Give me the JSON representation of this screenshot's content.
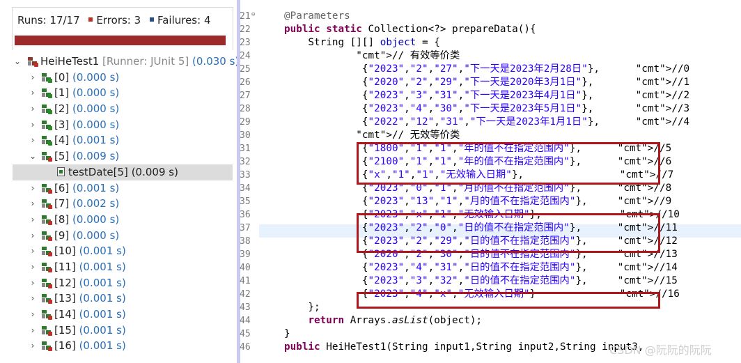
{
  "junit": {
    "runs_label": "Runs: 17/17",
    "errors_label": "Errors: 3",
    "failures_label": "Failures: 4",
    "root": {
      "name": "HeiHeTest1",
      "runner": "[Runner: JUnit 5]",
      "time": "(0.030 s)"
    },
    "cases": [
      {
        "name": "[0]",
        "time": "(0.000 s)"
      },
      {
        "name": "[1]",
        "time": "(0.000 s)"
      },
      {
        "name": "[2]",
        "time": "(0.000 s)"
      },
      {
        "name": "[3]",
        "time": "(0.000 s)"
      },
      {
        "name": "[4]",
        "time": "(0.001 s)"
      },
      {
        "name": "[5]",
        "time": "(0.009 s)"
      },
      {
        "name": "[6]",
        "time": "(0.001 s)"
      },
      {
        "name": "[7]",
        "time": "(0.002 s)"
      },
      {
        "name": "[8]",
        "time": "(0.000 s)"
      },
      {
        "name": "[9]",
        "time": "(0.000 s)"
      },
      {
        "name": "[10]",
        "time": "(0.001 s)"
      },
      {
        "name": "[11]",
        "time": "(0.001 s)"
      },
      {
        "name": "[12]",
        "time": "(0.001 s)"
      },
      {
        "name": "[13]",
        "time": "(0.001 s)"
      },
      {
        "name": "[14]",
        "time": "(0.001 s)"
      },
      {
        "name": "[15]",
        "time": "(0.001 s)"
      },
      {
        "name": "[16]",
        "time": "(0.001 s)"
      }
    ],
    "child": {
      "name": "testDate[5]",
      "time": "(0.009 s)"
    }
  },
  "editor": {
    "line_numbers": [
      "21",
      "22",
      "23",
      "24",
      "25",
      "26",
      "27",
      "28",
      "29",
      "30",
      "31",
      "32",
      "33",
      "34",
      "35",
      "36",
      "37",
      "38",
      "39",
      "40",
      "41",
      "42",
      "43",
      "44",
      "45",
      "46"
    ],
    "lines": [
      "@Parameters",
      "public static Collection<?> prepareData(){",
      "    String [][] object = {",
      "            // 有效等价类",
      "             {\"2023\",\"2\",\"27\",\"下一天是2023年2月28日\"},      //0",
      "             {\"2020\",\"2\",\"29\",\"下一天是2020年3月1日\"},       //1",
      "             {\"2023\",\"3\",\"31\",\"下一天是2023年4月1日\"},       //2",
      "             {\"2023\",\"4\",\"30\",\"下一天是2023年5月1日\"},       //3",
      "             {\"2022\",\"12\",\"31\",\"下一天是2023年1月1日\"},      //4",
      "            // 无效等价类",
      "             {\"1800\",\"1\",\"1\",\"年的值不在指定范围内\"},      //5",
      "             {\"2100\",\"1\",\"1\",\"年的值不在指定范围内\"},      //6",
      "             {\"x\",\"1\",\"1\",\"无效输入日期\"},                //7",
      "             {\"2023\",\"0\",\"1\",\"月的值不在指定范围内\"},      //8",
      "             {\"2023\",\"13\",\"1\",\"月的值不在指定范围内\"},     //9",
      "             {\"2023\",\"x\",\"1\",\"无效输入日期\"},             //10",
      "             {\"2023\",\"2\",\"0\",\"日的值不在指定范围内\"},      //11",
      "             {\"2023\",\"2\",\"29\",\"日的值不在指定范围内\"},     //12",
      "             {\"2020\",\"2\",\"30\",\"日的值不在指定范围内\"},     //13",
      "             {\"2023\",\"4\",\"31\",\"日的值不在指定范围内\"},     //14",
      "             {\"2023\",\"3\",\"32\",\"日的值不在指定范围内\"},     //15",
      "             {\"2023\",\"4\",\"x\",\"无效输入日期\"}              //16",
      "    };",
      "    return Arrays.asList(object);",
      "}",
      "public HeiHeTest1(String input1,String input2,String input3,"
    ]
  },
  "watermark": "CSDN @阮阮的阮阮",
  "colors": {
    "keyword": "#7f0055",
    "string": "#2a00ff",
    "comment": "#3f7f5f",
    "highlight_box": "#b0161b",
    "progress_bar": "#9d2a2a",
    "time_text": "#2a6fb8"
  }
}
